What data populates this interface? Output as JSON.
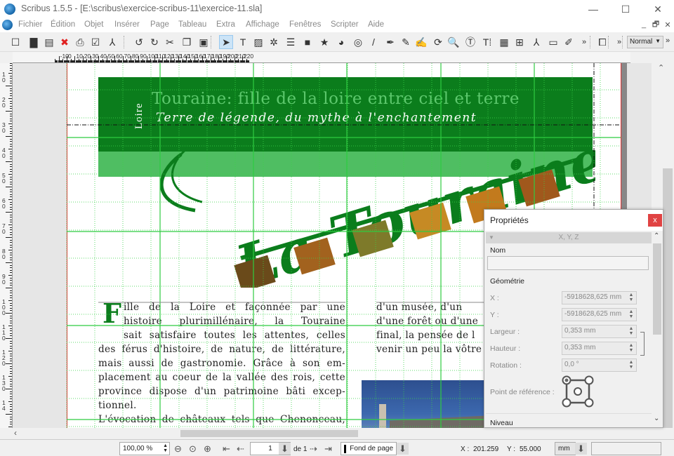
{
  "window": {
    "title": "Scribus 1.5.5 - [E:\\scribus\\exercice-scribus-11\\exercice-11.sla]",
    "controls": {
      "minimize": "—",
      "maximize": "☐",
      "close": "✕"
    }
  },
  "menubar": {
    "items": [
      "Fichier",
      "Édition",
      "Objet",
      "Insérer",
      "Page",
      "Tableau",
      "Extra",
      "Affichage",
      "Fenêtres",
      "Scripter",
      "Aide"
    ],
    "mdi_controls": [
      "_",
      "🗗",
      "✕"
    ]
  },
  "toolbar": {
    "icons": [
      {
        "name": "new-document-icon",
        "glyph": "☐"
      },
      {
        "name": "open-folder-icon",
        "glyph": "▇"
      },
      {
        "name": "save-icon",
        "glyph": "▤"
      },
      {
        "name": "close-document-icon",
        "glyph": "✖"
      },
      {
        "name": "print-icon",
        "glyph": "⎙"
      },
      {
        "name": "preflight-check-icon",
        "glyph": "☑"
      },
      {
        "name": "export-pdf-icon",
        "glyph": "⅄"
      },
      {
        "name": "undo-icon",
        "glyph": "↺"
      },
      {
        "name": "redo-icon",
        "glyph": "↻"
      },
      {
        "name": "cut-icon",
        "glyph": "✂"
      },
      {
        "name": "copy-icon",
        "glyph": "❐"
      },
      {
        "name": "paste-icon",
        "glyph": "▣"
      },
      {
        "name": "select-arrow-icon",
        "glyph": "➤"
      },
      {
        "name": "text-frame-icon",
        "glyph": "T"
      },
      {
        "name": "image-frame-icon",
        "glyph": "▨"
      },
      {
        "name": "render-frame-icon",
        "glyph": "✲"
      },
      {
        "name": "table-icon",
        "glyph": "☰"
      },
      {
        "name": "shape-icon",
        "glyph": "■"
      },
      {
        "name": "polygon-icon",
        "glyph": "★"
      },
      {
        "name": "arc-icon",
        "glyph": "◕"
      },
      {
        "name": "spiral-icon",
        "glyph": "◎"
      },
      {
        "name": "line-icon",
        "glyph": "/"
      },
      {
        "name": "bezier-icon",
        "glyph": "✒"
      },
      {
        "name": "freehand-icon",
        "glyph": "✎"
      },
      {
        "name": "calligraphic-icon",
        "glyph": "✍"
      },
      {
        "name": "rotate-icon",
        "glyph": "⟳"
      },
      {
        "name": "zoom-icon",
        "glyph": "🔍"
      },
      {
        "name": "edit-text-icon",
        "glyph": "Ⓣ"
      },
      {
        "name": "story-editor-icon",
        "glyph": "T⁞"
      },
      {
        "name": "link-frames-icon",
        "glyph": "▦"
      },
      {
        "name": "unlink-frames-icon",
        "glyph": "⊞"
      },
      {
        "name": "measure-icon",
        "glyph": "⅄"
      },
      {
        "name": "copy-properties-icon",
        "glyph": "▭"
      },
      {
        "name": "eyedropper-icon",
        "glyph": "✐"
      },
      {
        "name": "more-icon",
        "glyph": "»"
      },
      {
        "name": "preview-icon",
        "glyph": "⧠"
      },
      {
        "name": "more-icon-2",
        "glyph": "»"
      }
    ],
    "mode_select": "Normal",
    "more_end": "»"
  },
  "hruler": {
    "labels": [
      "-10",
      "0",
      "10",
      "20",
      "30",
      "40",
      "50",
      "60",
      "70",
      "80",
      "90",
      "100",
      "110",
      "120",
      "130",
      "140",
      "150",
      "160",
      "170",
      "180",
      "190",
      "200",
      "210",
      "220"
    ]
  },
  "vruler": {
    "labels": [
      "1\n0",
      "2\n0",
      "3\n0",
      "4\n0",
      "5\n0",
      "6\n0",
      "7\n0",
      "8\n0",
      "9\n0",
      "1\n0\n0",
      "1\n1\n0",
      "1\n2\n0",
      "1\n3\n0",
      "1\n4"
    ]
  },
  "document": {
    "kicker": "Loire",
    "headline": "Touraine: fille de la loire entre ciel et terre",
    "subheadline": "Terre de légende, du mythe à l'enchantement",
    "logo_text": "La Touraine",
    "dropcap": "F",
    "col1_lines": [
      "ille de la Loire et façonnée par une",
      "histoire plurimillénaire, la Touraine",
      "sait satisfaire toutes les attentes, celles",
      "des férus d'histoire, de nature, de littérature,",
      "mais aussi de gastronomie. Grâce à son em-",
      "placement au coeur de la vallée des rois, cette",
      "province dispose d'un patrimoine bâti excep-",
      "tionnel.",
      "L'évocation de châteaux tels que Chenonceau,"
    ],
    "col2_lines": [
      "d'un musée, d'un",
      "d'une forêt ou d'une",
      "final, la pensée de l",
      "venir un peu la vôtre"
    ],
    "colors": {
      "dark_green": "#0b7d1c",
      "light_green": "#4fbe62",
      "headline_green": "#5dc86d"
    }
  },
  "properties_panel": {
    "title": "Propriétés",
    "close": "x",
    "section": "X, Y, Z",
    "name_label": "Nom",
    "name_value": "",
    "geometry_label": "Géométrie",
    "fields": [
      {
        "label": "X :",
        "value": "-5918628,625 mm"
      },
      {
        "label": "Y :",
        "value": "-5918628,625 mm"
      },
      {
        "label": "Largeur :",
        "value": "0,353 mm"
      },
      {
        "label": "Hauteur :",
        "value": "0,353 mm"
      },
      {
        "label": "Rotation :",
        "value": "0,0 °"
      }
    ],
    "reference_label": "Point de référence :",
    "level_label": "Niveau"
  },
  "statusbar": {
    "zoom": "100,00 %",
    "page": "1",
    "page_of": "de 1",
    "layer": "Fond de page",
    "x_label": "X :",
    "x_value": "201.259",
    "y_label": "Y :",
    "y_value": "55.000",
    "unit": "mm"
  }
}
